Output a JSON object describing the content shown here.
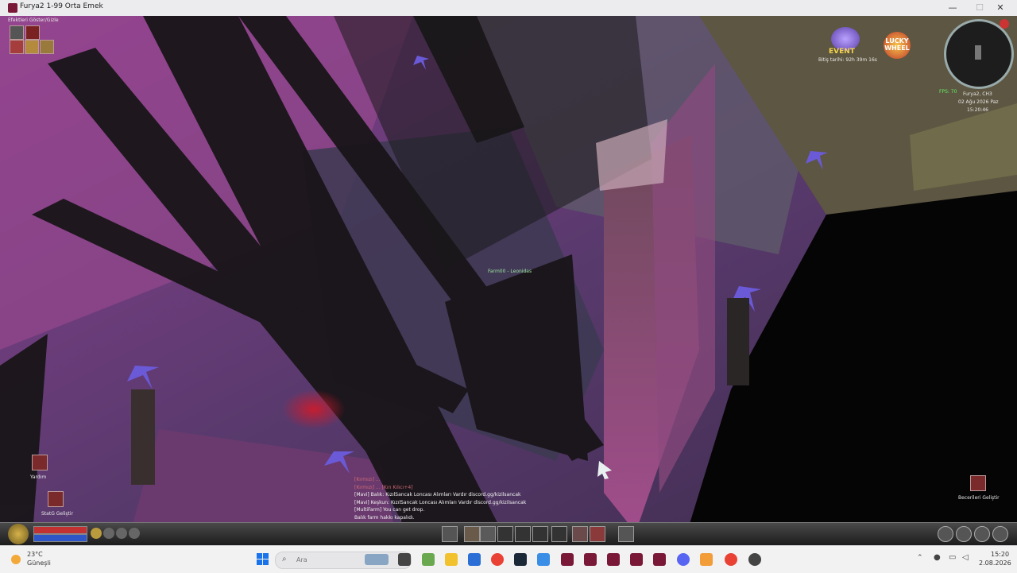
{
  "window": {
    "title": "Furya2 1-99 Orta Emek",
    "minimize_glyph": "—",
    "maximize_glyph": "☐",
    "close_glyph": "✕"
  },
  "hud": {
    "effects_toggle": "Efektleri Göster/Gizle",
    "event_label": "EVENT",
    "event_end": "Bitiş tarihi: 92h 39m 16s",
    "lucky_wheel": "LUCKY WHEEL",
    "fps": "FPS: 70",
    "server": "Furya2, CH3",
    "date": "02 Ağu 2026 Paz",
    "time": "15:20:46",
    "npc_name": "Farm00 - Leonidas",
    "help_label": "Yardım",
    "stat_label": "StatG Geliştir",
    "skills_label": "Becerileri Geliştir"
  },
  "chat": {
    "lines": [
      {
        "text": "[Kırmızı] ...",
        "style": "muted"
      },
      {
        "text": "[Kırmızı] ... [Kırı Kılıcı+4]",
        "style": "muted"
      },
      {
        "text": "[Mavi] Balık: KızılSancak Loncası Alımları Vardır discord.gg/kizilsancak",
        "style": "normal"
      },
      {
        "text": "[Mavi] Keşkun: KızılSancak Loncası Alımları Vardır discord.gg/kizilsancak",
        "style": "normal"
      },
      {
        "text": "[MultiFarm] You can get drop.",
        "style": "normal"
      },
      {
        "text": "Balık farm hakkı kapalıdı.",
        "style": "normal"
      }
    ]
  },
  "taskbar": {
    "weather_temp": "23°C",
    "weather_desc": "Güneşli",
    "search_placeholder": "Ara",
    "clock_time": "15:20",
    "clock_date": "2.08.2026"
  }
}
